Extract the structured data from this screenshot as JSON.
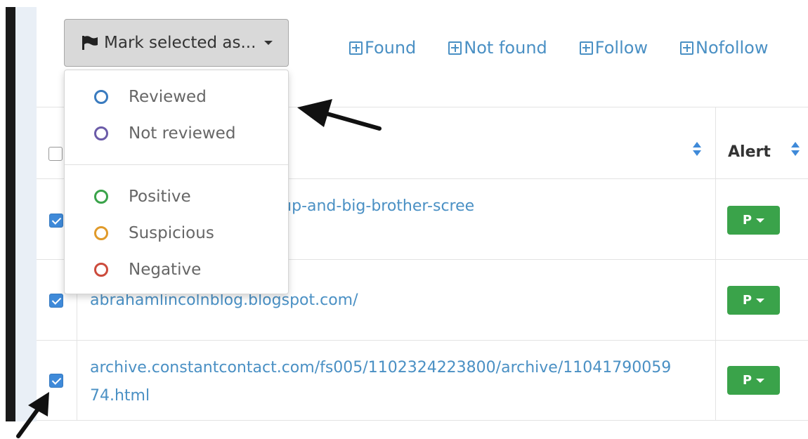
{
  "toolbar": {
    "mark_selected_label": "Mark selected as...",
    "filters": [
      {
        "label": "Found"
      },
      {
        "label": "Not found"
      },
      {
        "label": "Follow"
      },
      {
        "label": "Nofollow"
      }
    ]
  },
  "dropdown": {
    "groups": [
      [
        {
          "label": "Reviewed",
          "color": "#3a7bbf"
        },
        {
          "label": "Not reviewed",
          "color": "#6b5ba8"
        }
      ],
      [
        {
          "label": "Positive",
          "color": "#3aa34a"
        },
        {
          "label": "Suspicious",
          "color": "#e09a2a"
        },
        {
          "label": "Negative",
          "color": "#cc4b3c"
        }
      ]
    ]
  },
  "table": {
    "columns": {
      "alert": "Alert"
    },
    "rows": [
      {
        "checked": true,
        "url_lines": [
          "business/2012/04/hiring-up-and-big-brother-scree"
        ],
        "alert": "P"
      },
      {
        "checked": true,
        "url_lines": [
          "abrahamlincolnblog.blogspot.com/"
        ],
        "alert": "P"
      },
      {
        "checked": true,
        "url_lines": [
          "archive.constantcontact.com/fs005/1102324223800/archive/11041790059",
          "74.html"
        ],
        "alert": "P"
      }
    ]
  },
  "colors": {
    "link": "#4a90c4",
    "checkbox": "#3f8ad9",
    "alert_positive": "#3aa34a",
    "toolbar_button": "#d9d9d9"
  }
}
